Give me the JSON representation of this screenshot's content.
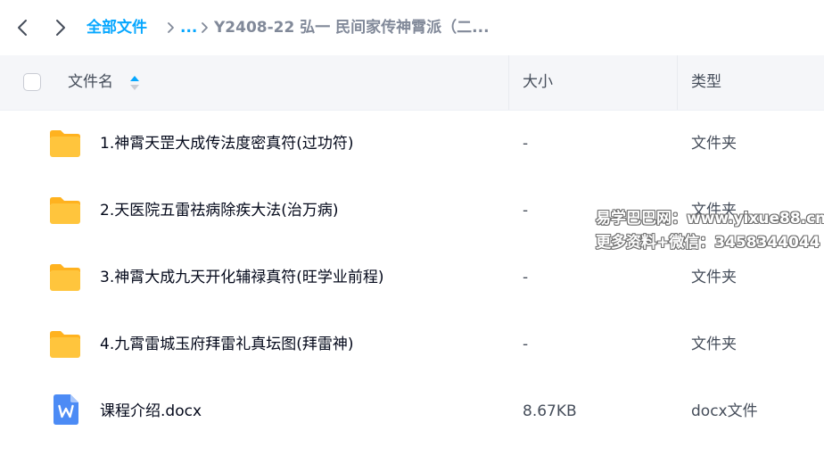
{
  "breadcrumb": {
    "root_label": "全部文件",
    "ellipsis": "...",
    "current": "Y2408-22 弘一 民间家传神霄派（二..."
  },
  "table": {
    "columns": {
      "name": "文件名",
      "size": "大小",
      "type": "类型"
    },
    "rows": [
      {
        "icon": "folder-icon",
        "name": "1.神霄天罡大成传法度密真符(过功符)",
        "size": "-",
        "type": "文件夹"
      },
      {
        "icon": "folder-icon",
        "name": "2.天医院五雷祛病除疾大法(治万病)",
        "size": "-",
        "type": "文件夹"
      },
      {
        "icon": "folder-icon",
        "name": "3.神霄大成九天开化辅禄真符(旺学业前程)",
        "size": "-",
        "type": "文件夹"
      },
      {
        "icon": "folder-icon",
        "name": "4.九霄雷城玉府拜雷礼真坛图(拜雷神)",
        "size": "-",
        "type": "文件夹"
      },
      {
        "icon": "word-doc-icon",
        "name": "课程介绍.docx",
        "size": "8.67KB",
        "type": "docx文件"
      }
    ]
  },
  "watermark": {
    "line1": "易学巴巴网：www.yixue88.cn",
    "line2": "更多资料+微信：3458344044"
  },
  "colors": {
    "accent": "#06a7ff",
    "folder": "#ffc53d",
    "folder_tab": "#ffb21f",
    "word_doc": "#4c8bf5",
    "header_bg": "#f5f6f9"
  }
}
